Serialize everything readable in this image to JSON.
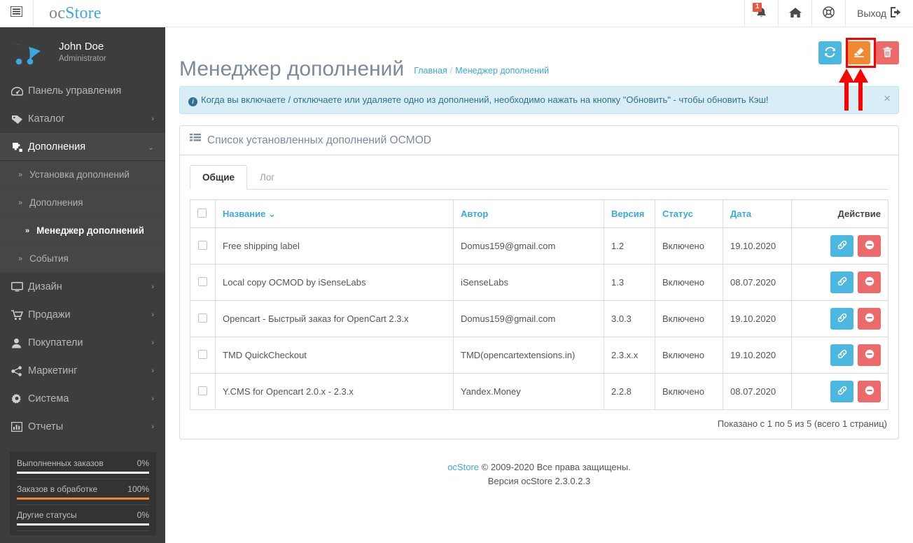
{
  "topbar": {
    "nav_toggle_icon": "sidebar-toggle-icon",
    "brand_prefix": "oc",
    "brand_suffix": "Store",
    "notifications": {
      "icon": "bell-icon",
      "count": "1"
    },
    "home": {
      "icon": "home-icon"
    },
    "support": {
      "icon": "lifebuoy-icon"
    },
    "logout": {
      "label": "Выход",
      "icon": "logout-icon"
    }
  },
  "sidebar": {
    "profile": {
      "name": "John Doe",
      "role": "Administrator",
      "logo_icon": "cart-logo-icon"
    },
    "items": [
      {
        "label": "Панель управления",
        "icon": "dashboard-icon",
        "caret": ""
      },
      {
        "label": "Каталог",
        "icon": "tag-icon",
        "caret": "›"
      },
      {
        "label": "Дополнения",
        "icon": "puzzle-icon",
        "caret": "⌄",
        "open": true
      },
      {
        "label": "Дизайн",
        "icon": "monitor-icon",
        "caret": "›"
      },
      {
        "label": "Продажи",
        "icon": "cart-icon",
        "caret": "›"
      },
      {
        "label": "Покупатели",
        "icon": "user-icon",
        "caret": "›"
      },
      {
        "label": "Маркетинг",
        "icon": "share-icon",
        "caret": "›"
      },
      {
        "label": "Система",
        "icon": "gear-icon",
        "caret": "›"
      },
      {
        "label": "Отчеты",
        "icon": "bar-chart-icon",
        "caret": "›"
      }
    ],
    "submenu": [
      {
        "label": "Установка дополнений",
        "active": false
      },
      {
        "label": "Дополнения",
        "active": false
      },
      {
        "label": "Менеджер дополнений",
        "active": true
      },
      {
        "label": "События",
        "active": false
      }
    ],
    "stats": [
      {
        "label": "Выполненных заказов",
        "value": "0%",
        "percent": 0,
        "color": "#ffffff"
      },
      {
        "label": "Заказов в обработке",
        "value": "100%",
        "percent": 100,
        "color": "#f0892f"
      },
      {
        "label": "Другие статусы",
        "value": "0%",
        "percent": 0,
        "color": "#ffffff"
      }
    ]
  },
  "page": {
    "title": "Менеджер дополнений",
    "breadcrumb_home": "Главная",
    "breadcrumb_sep": "/",
    "breadcrumb_current": "Менеджер дополнений",
    "actions": [
      {
        "name": "refresh-button",
        "icon": "refresh-icon",
        "color": "#4ab8e0"
      },
      {
        "name": "clear-cache-button",
        "icon": "eraser-icon",
        "color": "#f0892f",
        "highlighted": true
      },
      {
        "name": "delete-button",
        "icon": "trash-icon",
        "color": "#ec6a6a"
      }
    ],
    "annotation": {
      "highlight_color": "#ff0000",
      "arrow_count": 2
    }
  },
  "alert": {
    "icon": "info-icon",
    "text": "Когда вы включаете / отключаете или удаляете одно из дополнений, необходимо нажать на кнопку \"Обновить\" - чтобы обновить Кэш!",
    "close": "×"
  },
  "panel": {
    "icon": "list-icon",
    "heading": "Список установленных дополнений OCMOD",
    "tabs": [
      {
        "label": "Общие",
        "active": true
      },
      {
        "label": "Лог",
        "active": false
      }
    ],
    "table": {
      "headers": {
        "name": "Название",
        "name_caret": "⌄",
        "author": "Автор",
        "version": "Версия",
        "status": "Статус",
        "date": "Дата",
        "action": "Действие"
      },
      "rows": [
        {
          "name": "Free shipping label",
          "author": "Domus159@gmail.com",
          "version": "1.2",
          "status": "Включено",
          "date": "19.10.2020"
        },
        {
          "name": "Local copy OCMOD by iSenseLabs",
          "author": "iSenseLabs",
          "version": "1.3",
          "status": "Включено",
          "date": "08.07.2020"
        },
        {
          "name": "Opencart - Быстрый заказ for OpenCart 2.3.x",
          "author": "Domus159@gmail.com",
          "version": "3.0.3",
          "status": "Включено",
          "date": "19.10.2020"
        },
        {
          "name": "TMD QuickCheckout",
          "author": "TMD(opencartextensions.in)",
          "version": "2.3.x.x",
          "status": "Включено",
          "date": "19.10.2020"
        },
        {
          "name": "Y.CMS for Opencart 2.0.x - 2.3.x",
          "author": "Yandex.Money",
          "version": "2.2.8",
          "status": "Включено",
          "date": "08.07.2020"
        }
      ],
      "row_actions": [
        {
          "name": "edit-link-button",
          "icon": "link-icon"
        },
        {
          "name": "disable-button",
          "icon": "minus-circle-icon"
        }
      ],
      "results": "Показано с 1 по 5 из 5 (всего 1 страниц)"
    }
  },
  "footer": {
    "brand_link": "ocStore",
    "copyright": " © 2009-2020 Все права защищены.",
    "version": "Версия ocStore 2.3.0.2.3"
  }
}
